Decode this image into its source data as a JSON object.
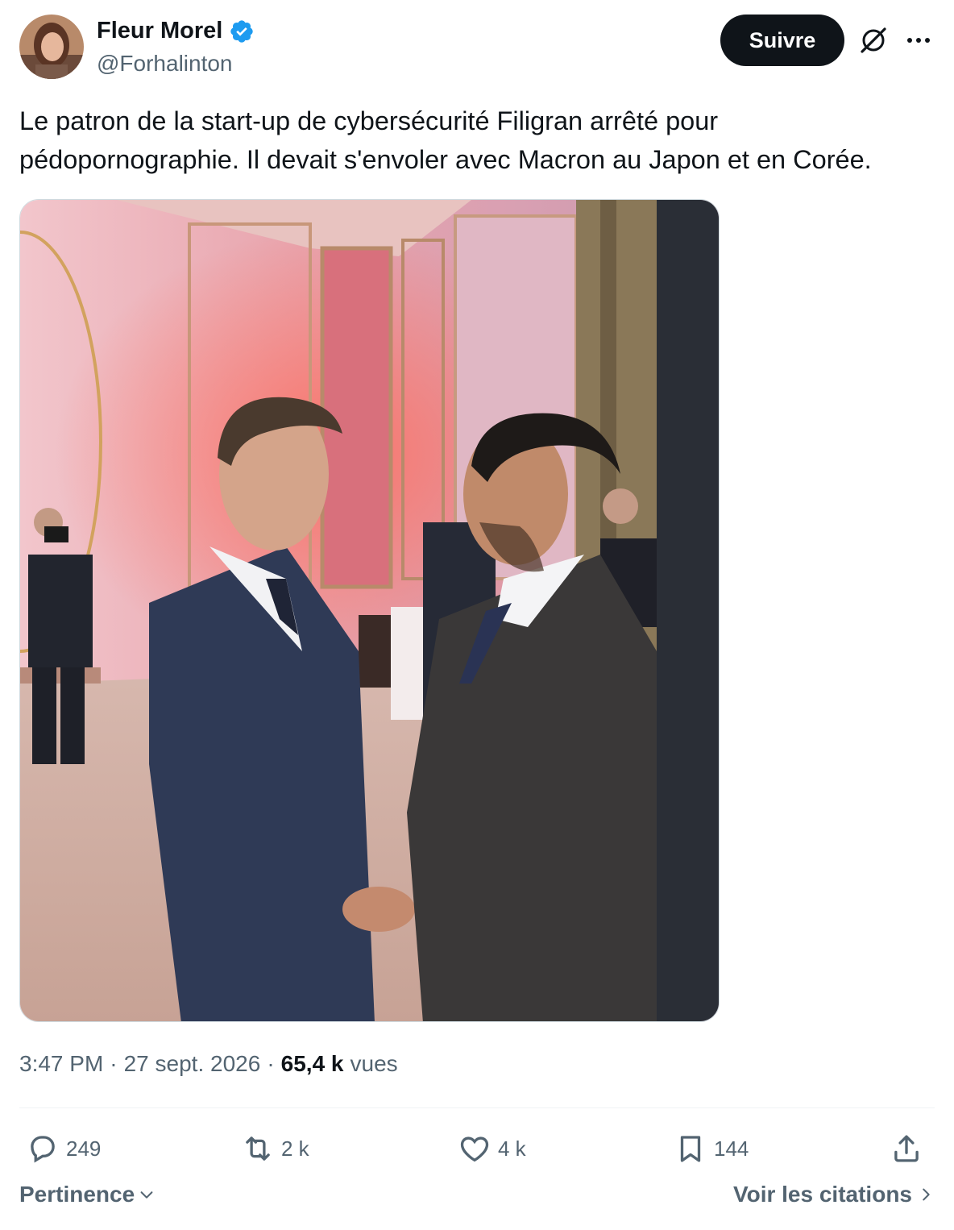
{
  "author": {
    "display_name": "Fleur Morel",
    "handle": "@Forhalinton",
    "verified": true,
    "verified_color": "#1d9bf0"
  },
  "header": {
    "follow_label": "Suivre",
    "grok_icon": "grok-slash-icon",
    "more_icon": "more-dots-icon"
  },
  "tweet": {
    "text": "Le patron de la start-up de cybersécurité Filigran arrêté pour\npédopornographie. Il devait s'envoler avec Macron au Japon et en Corée."
  },
  "meta": {
    "time": "3:47 PM",
    "separator": "·",
    "date": "27 sept. 2026",
    "views_count": "65,4 k",
    "views_label": "vues"
  },
  "actions": {
    "replies": "249",
    "reposts": "2 k",
    "likes": "4 k",
    "bookmarks": "144"
  },
  "footer": {
    "sort_label": "Pertinence",
    "quotes_label": "Voir les citations"
  },
  "colors": {
    "text": "#0f1419",
    "secondary": "#536471",
    "accent": "#1d9bf0"
  }
}
